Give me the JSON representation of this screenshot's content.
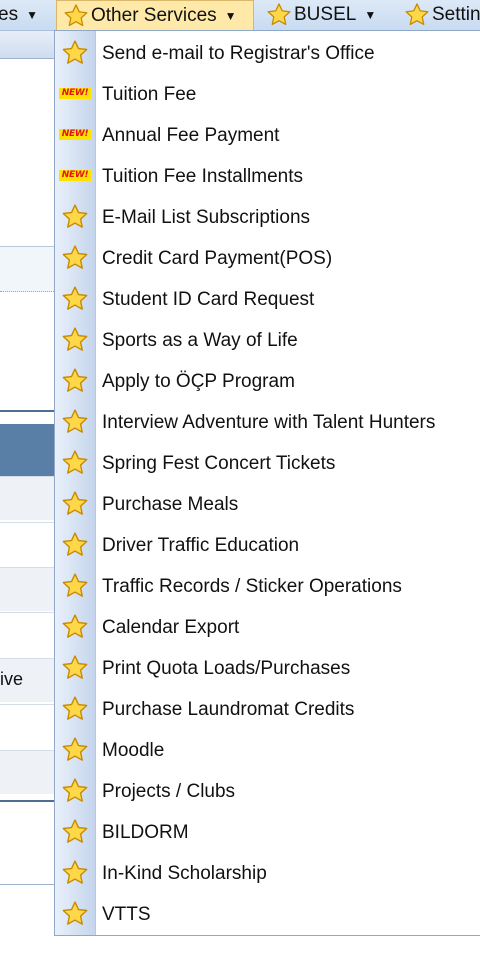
{
  "menubar": {
    "items": [
      {
        "label": "es",
        "active": false
      },
      {
        "label": "Other Services",
        "active": true
      },
      {
        "label": "BUSEL",
        "active": false
      },
      {
        "label": "Settin",
        "active": false
      }
    ]
  },
  "background": {
    "partial_text": "ive"
  },
  "dropdown": {
    "items": [
      {
        "label": "Send e-mail to Registrar's Office",
        "icon": "star-icon"
      },
      {
        "label": "Tuition Fee",
        "icon": "new-icon"
      },
      {
        "label": "Annual Fee Payment",
        "icon": "new-icon"
      },
      {
        "label": "Tuition Fee Installments",
        "icon": "new-icon"
      },
      {
        "label": "E-Mail List Subscriptions",
        "icon": "star-icon"
      },
      {
        "label": "Credit Card Payment(POS)",
        "icon": "star-icon"
      },
      {
        "label": "Student ID Card Request",
        "icon": "star-icon"
      },
      {
        "label": "Sports as a Way of Life",
        "icon": "star-icon"
      },
      {
        "label": "Apply to ÖÇP Program",
        "icon": "star-icon"
      },
      {
        "label": "Interview Adventure with Talent Hunters",
        "icon": "star-icon"
      },
      {
        "label": "Spring Fest Concert Tickets",
        "icon": "star-icon"
      },
      {
        "label": "Purchase Meals",
        "icon": "star-icon"
      },
      {
        "label": "Driver Traffic Education",
        "icon": "star-icon"
      },
      {
        "label": "Traffic Records / Sticker Operations",
        "icon": "star-icon"
      },
      {
        "label": "Calendar Export",
        "icon": "star-icon"
      },
      {
        "label": "Print Quota Loads/Purchases",
        "icon": "star-icon"
      },
      {
        "label": "Purchase Laundromat Credits",
        "icon": "star-icon"
      },
      {
        "label": "Moodle",
        "icon": "star-icon"
      },
      {
        "label": "Projects / Clubs",
        "icon": "star-icon"
      },
      {
        "label": "BILDORM",
        "icon": "star-icon"
      },
      {
        "label": "In-Kind Scholarship",
        "icon": "star-icon"
      },
      {
        "label": "VTTS",
        "icon": "star-icon"
      }
    ],
    "new_badge_text": "NEW!"
  }
}
